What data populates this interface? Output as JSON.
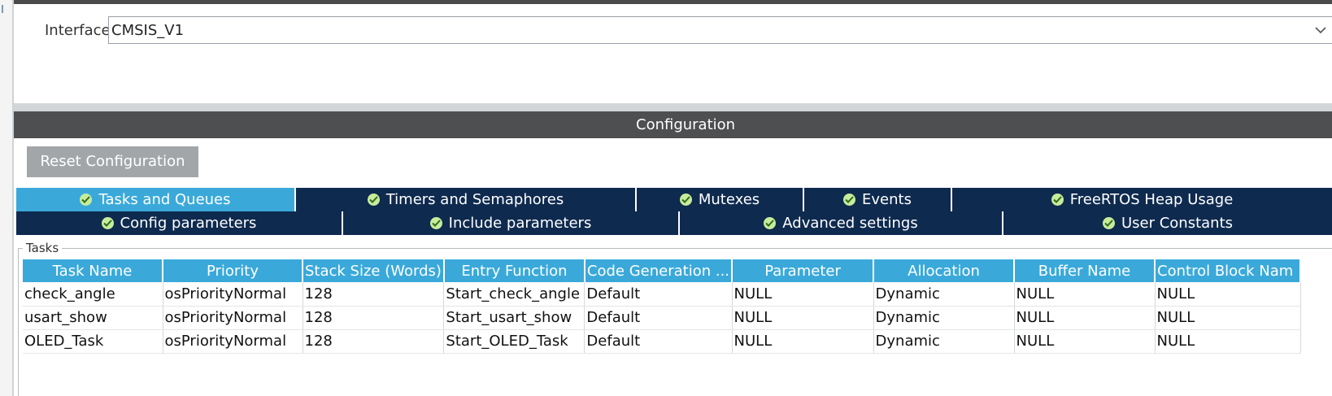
{
  "interface": {
    "label": "Interface",
    "selected": "CMSIS_V1"
  },
  "configuration": {
    "title": "Configuration",
    "reset_button": "Reset Configuration"
  },
  "tabs_row1": [
    {
      "label": "Tasks and Queues",
      "active": true,
      "icon": "check-circle-icon"
    },
    {
      "label": "Timers and Semaphores",
      "active": false,
      "icon": "check-circle-icon"
    },
    {
      "label": "Mutexes",
      "active": false,
      "icon": "check-circle-icon"
    },
    {
      "label": "Events",
      "active": false,
      "icon": "check-circle-icon"
    },
    {
      "label": "FreeRTOS Heap Usage",
      "active": false,
      "icon": "check-circle-icon"
    }
  ],
  "tabs_row2": [
    {
      "label": "Config parameters",
      "active": false,
      "icon": "check-circle-icon"
    },
    {
      "label": "Include parameters",
      "active": false,
      "icon": "check-circle-icon"
    },
    {
      "label": "Advanced settings",
      "active": false,
      "icon": "check-circle-icon"
    },
    {
      "label": "User Constants",
      "active": false,
      "icon": "check-circle-icon"
    }
  ],
  "tasks": {
    "legend": "Tasks",
    "columns": [
      "Task Name",
      "Priority",
      "Stack Size (Words)",
      "Entry Function",
      "Code Generation ...",
      "Parameter",
      "Allocation",
      "Buffer Name",
      "Control Block Nam"
    ],
    "rows": [
      [
        "check_angle",
        "osPriorityNormal",
        "128",
        "Start_check_angle",
        "Default",
        "NULL",
        "Dynamic",
        "NULL",
        "NULL"
      ],
      [
        "usart_show",
        "osPriorityNormal",
        "128",
        "Start_usart_show",
        "Default",
        "NULL",
        "Dynamic",
        "NULL",
        "NULL"
      ],
      [
        "OLED_Task",
        "osPriorityNormal",
        "128",
        "Start_OLED_Task",
        "Default",
        "NULL",
        "Dynamic",
        "NULL",
        "NULL"
      ]
    ]
  },
  "colors": {
    "tab_active": "#3aa9da",
    "tab_inactive": "#0e2a4f",
    "header_bar": "#4d4f51",
    "check_icon": "#c7ec9a"
  }
}
